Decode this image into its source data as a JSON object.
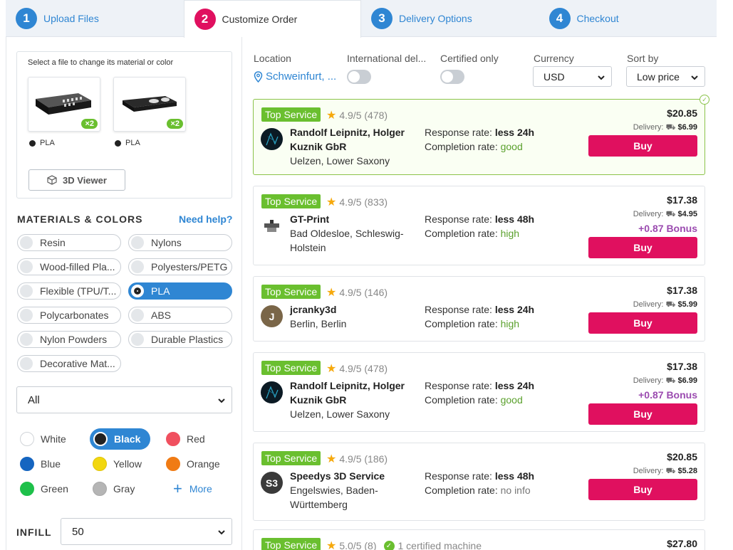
{
  "steps": [
    {
      "num": "1",
      "label": "Upload Files"
    },
    {
      "num": "2",
      "label": "Customize Order"
    },
    {
      "num": "3",
      "label": "Delivery Options"
    },
    {
      "num": "4",
      "label": "Checkout"
    }
  ],
  "files": {
    "hint": "Select a file to change its material or color",
    "items": [
      {
        "qty": "×2",
        "material": "PLA"
      },
      {
        "qty": "×2",
        "material": "PLA"
      }
    ],
    "viewer_label": "3D Viewer"
  },
  "materials": {
    "title": "MATERIALS & COLORS",
    "help": "Need help?",
    "options": [
      "Resin",
      "Nylons",
      "Wood-filled Pla...",
      "Polyesters/PETG",
      "Flexible (TPU/T...",
      "PLA",
      "Polycarbonates",
      "ABS",
      "Nylon Powders",
      "Durable Plastics",
      "Decorative Mat..."
    ],
    "selected": "PLA",
    "finish_select": "All"
  },
  "colors": {
    "options": [
      {
        "name": "White",
        "hex": "#ffffff"
      },
      {
        "name": "Black",
        "hex": "#222222"
      },
      {
        "name": "Red",
        "hex": "#f0505f"
      },
      {
        "name": "Blue",
        "hex": "#1565c0"
      },
      {
        "name": "Yellow",
        "hex": "#f2d70f"
      },
      {
        "name": "Orange",
        "hex": "#f07b14"
      },
      {
        "name": "Green",
        "hex": "#1ec04a"
      },
      {
        "name": "Gray",
        "hex": "#b5b5b5"
      }
    ],
    "selected": "Black",
    "more_label": "More"
  },
  "infill": {
    "label": "INFILL",
    "value": "50"
  },
  "filters": {
    "location_label": "Location",
    "location_value": "Schweinfurt, ...",
    "intl_label": "International del...",
    "certified_label": "Certified only",
    "currency_label": "Currency",
    "currency_value": "USD",
    "sort_label": "Sort by",
    "sort_value": "Low price"
  },
  "offers": [
    {
      "badge": "Top Service",
      "rating": "4.9/5",
      "reviews": "(478)",
      "name": "Randolf Leipnitz, Holger Kuznik GbR",
      "location": "Uelzen, Lower Saxony",
      "response_label": "Response rate:",
      "response": "less 24h",
      "completion_label": "Completion rate:",
      "completion": "good",
      "price": "$20.85",
      "delivery_label": "Delivery:",
      "delivery": "$6.99",
      "bonus": "",
      "buy": "Buy",
      "avatar": "",
      "avatar_color": "#0b1a24"
    },
    {
      "badge": "Top Service",
      "rating": "4.9/5",
      "reviews": "(833)",
      "name": "GT-Print",
      "location": "Bad Oldesloe, Schleswig-Holstein",
      "response_label": "Response rate:",
      "response": "less 48h",
      "completion_label": "Completion rate:",
      "completion": "high",
      "price": "$17.38",
      "delivery_label": "Delivery:",
      "delivery": "$4.95",
      "bonus": "+0.87 Bonus",
      "buy": "Buy",
      "avatar": "",
      "avatar_color": "#ffffff"
    },
    {
      "badge": "Top Service",
      "rating": "4.9/5",
      "reviews": "(146)",
      "name": "jcranky3d",
      "location": "Berlin, Berlin",
      "response_label": "Response rate:",
      "response": "less 24h",
      "completion_label": "Completion rate:",
      "completion": "high",
      "price": "$17.38",
      "delivery_label": "Delivery:",
      "delivery": "$5.99",
      "bonus": "",
      "buy": "Buy",
      "avatar": "J",
      "avatar_color": "#7a6648"
    },
    {
      "badge": "Top Service",
      "rating": "4.9/5",
      "reviews": "(478)",
      "name": "Randolf Leipnitz, Holger Kuznik GbR",
      "location": "Uelzen, Lower Saxony",
      "response_label": "Response rate:",
      "response": "less 24h",
      "completion_label": "Completion rate:",
      "completion": "good",
      "price": "$17.38",
      "delivery_label": "Delivery:",
      "delivery": "$6.99",
      "bonus": "+0.87 Bonus",
      "buy": "Buy",
      "avatar": "",
      "avatar_color": "#0b1a24"
    },
    {
      "badge": "Top Service",
      "rating": "4.9/5",
      "reviews": "(186)",
      "name": "Speedys 3D Service",
      "location": "Engelswies, Baden-Württemberg",
      "response_label": "Response rate:",
      "response": "less 48h",
      "completion_label": "Completion rate:",
      "completion": "no info",
      "price": "$20.85",
      "delivery_label": "Delivery:",
      "delivery": "$5.28",
      "bonus": "",
      "buy": "Buy",
      "avatar": "S3",
      "avatar_color": "#3a3a3a"
    },
    {
      "badge": "Top Service",
      "rating": "5.0/5",
      "reviews": "(8)",
      "certified": "1 certified machine",
      "price": "$27.80"
    }
  ]
}
